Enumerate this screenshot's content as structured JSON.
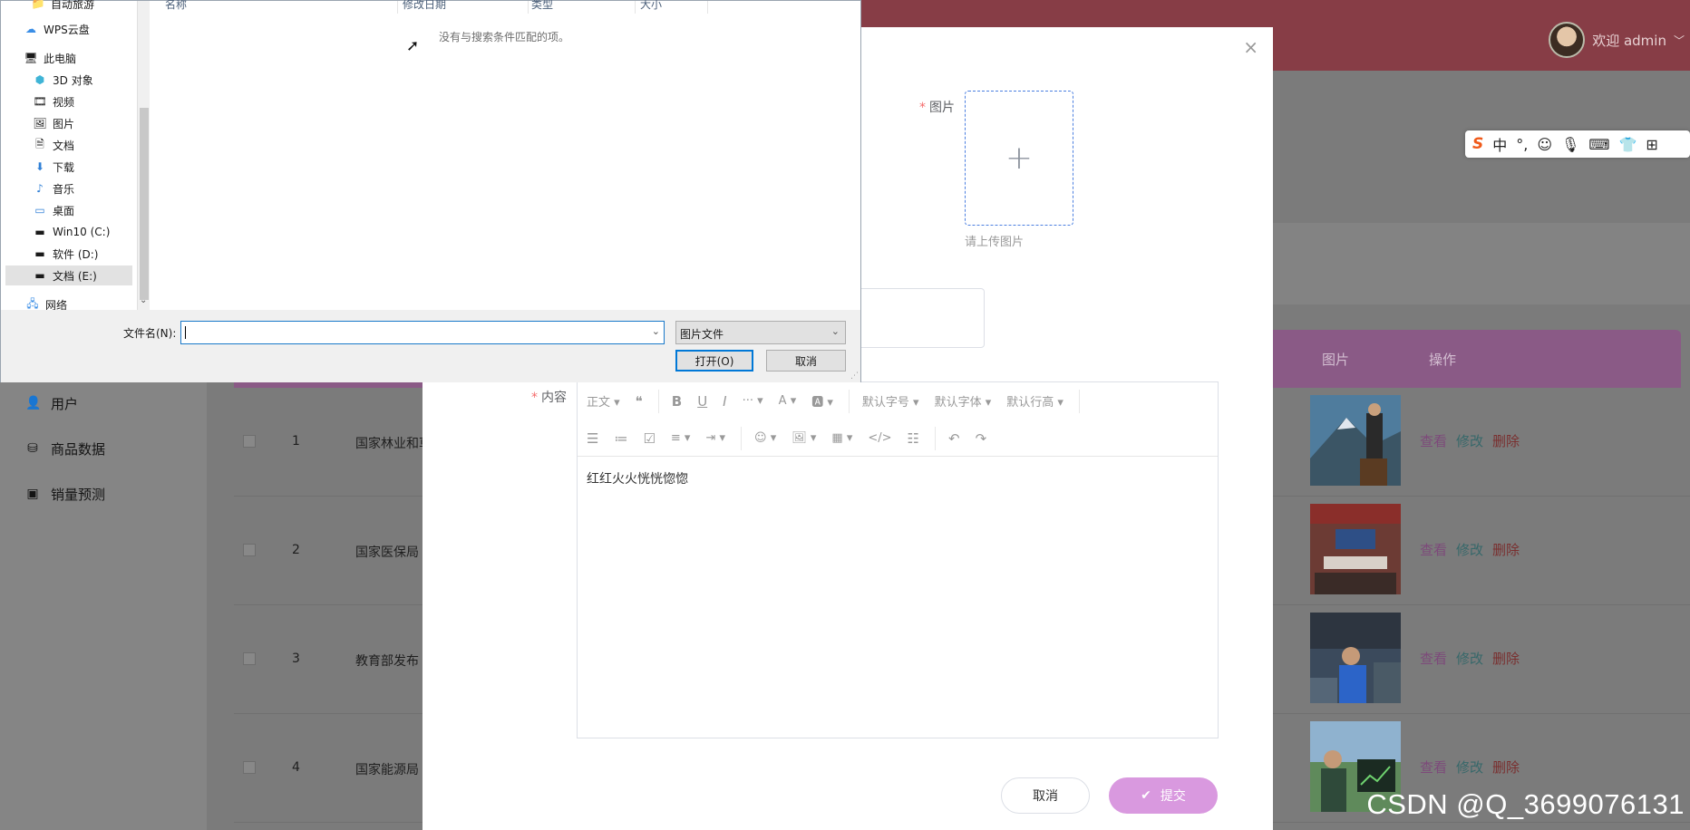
{
  "header": {
    "welcome": "欢迎 admin",
    "chevron": "﹀"
  },
  "sidebar": {
    "items": [
      {
        "label": "用户",
        "icon": "user-icon",
        "glyph": "👤"
      },
      {
        "label": "商品数据",
        "icon": "database-icon",
        "glyph": "⛁"
      },
      {
        "label": "销量预测",
        "icon": "chart-icon",
        "glyph": "▣"
      }
    ]
  },
  "table": {
    "columns": [
      "图片",
      "操作"
    ],
    "rows": [
      {
        "index": "1",
        "title": "国家林业和草"
      },
      {
        "index": "2",
        "title": "国家医保局"
      },
      {
        "index": "3",
        "title": "教育部发布"
      },
      {
        "index": "4",
        "title": "国家能源局"
      }
    ],
    "actions": {
      "view": "查看",
      "edit": "修改",
      "delete": "删除"
    }
  },
  "modal": {
    "close_glyph": "×",
    "image_label": "图片",
    "required_mark": "*",
    "upload_plus": "+",
    "upload_hint": "请上传图片",
    "content_label": "内容",
    "editor": {
      "toolbar_row1": [
        "正文 ▾",
        "❝",
        "B",
        "U",
        "I",
        "··· ▾",
        "A ▾",
        "🅰 ▾",
        "默认字号 ▾",
        "默认字体 ▾",
        "默认行高 ▾"
      ],
      "toolbar_row2": [
        "☰",
        "≔",
        "☑",
        "≡ ▾",
        "⇥ ▾",
        "☺ ▾",
        "🖼 ▾",
        "▦ ▾",
        "</>",
        "☷",
        "↶",
        "↷"
      ],
      "content": "红红火火恍恍惚惚"
    },
    "cancel_label": "取消",
    "submit_label": "提交",
    "submit_icon": "✔"
  },
  "ime": {
    "logo": "S",
    "items": [
      "中",
      "°,",
      "☺",
      "🎙",
      "⌨",
      "👕",
      "⊞"
    ]
  },
  "watermark": "CSDN @Q_3699076131",
  "file_dialog": {
    "nav_items": [
      {
        "label": "自动旅游",
        "glyph": "📁",
        "icon": "folder-icon"
      },
      {
        "label": "WPS云盘",
        "glyph": "☁",
        "icon": "cloud-icon"
      },
      {
        "label": "此电脑",
        "glyph": "🖥",
        "icon": "computer-icon"
      },
      {
        "label": "3D 对象",
        "glyph": "⬢",
        "icon": "cube-icon"
      },
      {
        "label": "视频",
        "glyph": "🎞",
        "icon": "video-icon"
      },
      {
        "label": "图片",
        "glyph": "🖼",
        "icon": "pictures-icon"
      },
      {
        "label": "文档",
        "glyph": "🗎",
        "icon": "documents-icon"
      },
      {
        "label": "下载",
        "glyph": "⬇",
        "icon": "download-icon"
      },
      {
        "label": "音乐",
        "glyph": "♪",
        "icon": "music-icon"
      },
      {
        "label": "桌面",
        "glyph": "▭",
        "icon": "desktop-icon"
      },
      {
        "label": "Win10 (C:)",
        "glyph": "▬",
        "icon": "drive-icon"
      },
      {
        "label": "软件 (D:)",
        "glyph": "▬",
        "icon": "drive-icon"
      },
      {
        "label": "文档 (E:)",
        "glyph": "▬",
        "icon": "drive-icon"
      },
      {
        "label": "网络",
        "glyph": "🖧",
        "icon": "network-icon"
      }
    ],
    "columns": [
      "名称",
      "修改日期",
      "类型",
      "大小"
    ],
    "empty_message": "没有与搜索条件匹配的项。",
    "filename_label": "文件名(N):",
    "filename_value": "",
    "filetype_value": "图片文件",
    "open_label": "打开(O)",
    "cancel_label": "取消",
    "dropdown_glyph": "⌄"
  }
}
